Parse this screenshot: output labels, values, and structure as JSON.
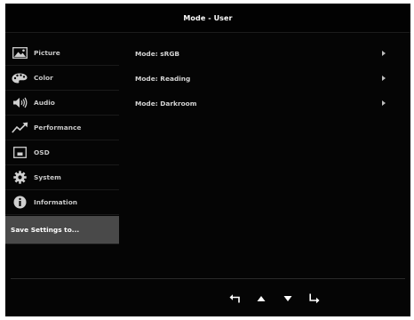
{
  "title": "Mode - User",
  "sidebar": {
    "items": [
      {
        "label": "Picture",
        "icon": "picture-icon"
      },
      {
        "label": "Color",
        "icon": "palette-icon"
      },
      {
        "label": "Audio",
        "icon": "speaker-icon"
      },
      {
        "label": "Performance",
        "icon": "trend-chart-icon"
      },
      {
        "label": "OSD",
        "icon": "osd-window-icon"
      },
      {
        "label": "System",
        "icon": "gear-icon"
      },
      {
        "label": "Information",
        "icon": "info-icon"
      },
      {
        "label": "Save Settings to...",
        "icon": ""
      }
    ],
    "selected": "Save Settings to..."
  },
  "modes": [
    {
      "label": "Mode: sRGB"
    },
    {
      "label": "Mode: Reading"
    },
    {
      "label": "Mode: Darkroom"
    }
  ],
  "nav": {
    "buttons": [
      "back-arrow-icon",
      "up-arrow-icon",
      "down-arrow-icon",
      "enter-arrow-icon"
    ]
  },
  "colors": {
    "background": "#050505",
    "selected_bg": "#494949",
    "text": "#c8c8c8"
  }
}
